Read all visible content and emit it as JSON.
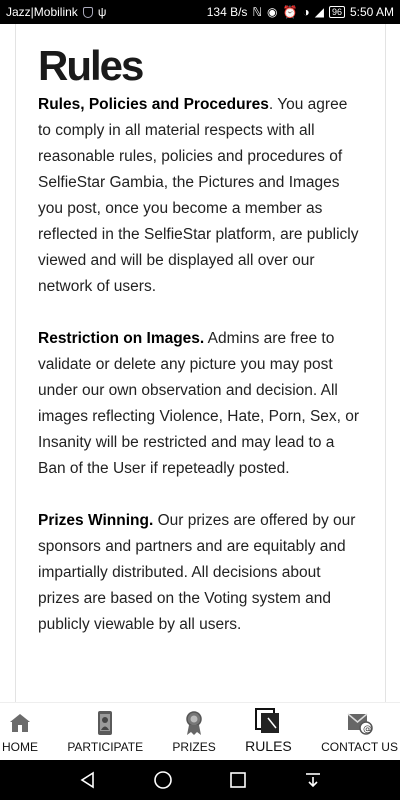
{
  "status_bar": {
    "carrier": "Jazz|Mobilink",
    "network_speed": "134 B/s",
    "battery": "96",
    "time": "5:50 AM"
  },
  "page": {
    "title": "Rules"
  },
  "sections": [
    {
      "heading": "Rules, Policies and Procedures",
      "body": ". You agree to comply in all material respects with all reasonable rules, policies and procedures of SelfieStar Gambia, the Pictures and Images you post, once you become a member as reflected in the SelfieStar platform, are publicly viewed and will be displayed all over our network of users."
    },
    {
      "heading": "Restriction on Images.",
      "body": " Admins are free to validate or delete any picture you may post under our own observation and decision. All images reflecting Violence, Hate, Porn, Sex, or Insanity will be restricted and may lead to a Ban of the User if repeteadly posted."
    },
    {
      "heading": "Prizes Winning.",
      "body": " Our prizes are offered by our sponsors and partners and are equitably and impartially distributed. All decisions about prizes are based on the Voting system and publicly viewable by all users."
    }
  ],
  "bottom_nav": {
    "items": [
      {
        "label": "HOME",
        "icon": "home-icon"
      },
      {
        "label": "PARTICIPATE",
        "icon": "participate-icon"
      },
      {
        "label": "PRIZES",
        "icon": "medal-icon"
      },
      {
        "label": "RULES",
        "icon": "rules-icon",
        "active": true
      },
      {
        "label": "CONTACT US",
        "icon": "contact-icon"
      }
    ]
  },
  "system_nav": {
    "buttons": [
      "back-icon",
      "home-circle-icon",
      "recents-icon",
      "notifications-pull-icon"
    ]
  }
}
